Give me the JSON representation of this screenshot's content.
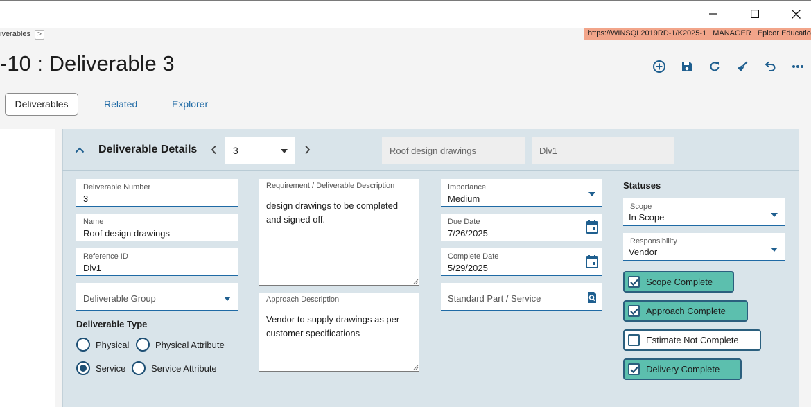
{
  "breadcrumb": {
    "label": "iverables",
    "chevron": ">"
  },
  "environment": {
    "url": "https://WINSQL2019RD-1/K2025-1",
    "user": "MANAGER",
    "company": "Epicor Education"
  },
  "page": {
    "title": "-10 : Deliverable 3"
  },
  "toolbar": {
    "icons": [
      "add-circle-icon",
      "save-icon",
      "refresh-icon",
      "clear-broom-icon",
      "undo-icon",
      "more-icon"
    ]
  },
  "tabs": {
    "deliverables": "Deliverables",
    "related": "Related",
    "explorer": "Explorer"
  },
  "section": {
    "title": "Deliverable Details",
    "selector_value": "3",
    "header_name": "Roof design drawings",
    "header_ref": "Dlv1"
  },
  "fields": {
    "number": {
      "label": "Deliverable Number",
      "value": "3"
    },
    "name": {
      "label": "Name",
      "value": "Roof design drawings"
    },
    "reference": {
      "label": "Reference ID",
      "value": "Dlv1"
    },
    "group": {
      "placeholder": "Deliverable Group"
    },
    "requirement": {
      "label": "Requirement / Deliverable Description",
      "value": "design drawings to be completed and signed off."
    },
    "approach": {
      "label": "Approach Description",
      "value": "Vendor to supply drawings as per customer specifications"
    },
    "importance": {
      "label": "Importance",
      "value": "Medium"
    },
    "due_date": {
      "label": "Due Date",
      "value": "7/26/2025"
    },
    "complete_date": {
      "label": "Complete Date",
      "value": "5/29/2025"
    },
    "part": {
      "placeholder": "Standard Part / Service"
    }
  },
  "deliverable_type": {
    "title": "Deliverable Type",
    "options": [
      "Physical",
      "Physical Attribute",
      "Service",
      "Service Attribute"
    ],
    "selected": "Service"
  },
  "statuses": {
    "title": "Statuses",
    "scope": {
      "label": "Scope",
      "value": "In Scope"
    },
    "responsibility": {
      "label": "Responsibility",
      "value": "Vendor"
    },
    "checks": [
      {
        "label": "Scope Complete",
        "checked": true
      },
      {
        "label": "Approach Complete",
        "checked": true
      },
      {
        "label": "Estimate Not Complete",
        "checked": false
      },
      {
        "label": "Delivery Complete",
        "checked": true
      }
    ]
  },
  "colors": {
    "accent": "#1f6aa5",
    "panel": "#d9e4ea",
    "check_on": "#5cbfae",
    "env_bar": "#f2a58a"
  }
}
